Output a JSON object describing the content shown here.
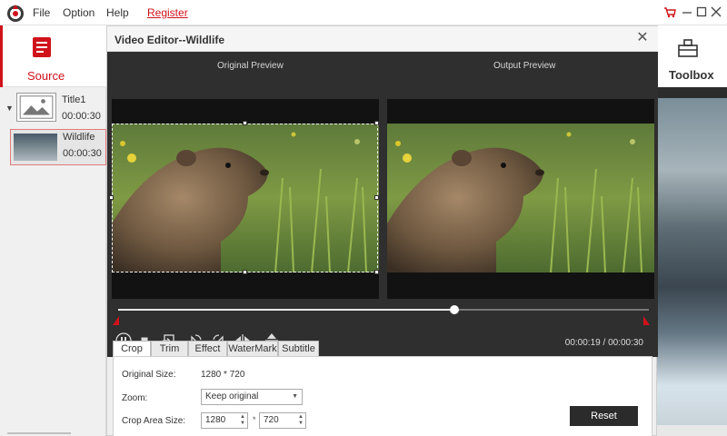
{
  "menu": {
    "file": "File",
    "option": "Option",
    "help": "Help",
    "register": "Register",
    "register_color": "#d0121b"
  },
  "window_controls": {
    "cart": "cart-icon",
    "minimize": "minimize-icon",
    "maximize": "maximize-icon",
    "close": "close-icon"
  },
  "sidebar": {
    "source_label": "Source",
    "title_item": {
      "name": "Title1",
      "duration": "00:00:30"
    },
    "clip_item": {
      "name": "Wildlife",
      "duration": "00:00:30"
    }
  },
  "toolbox": {
    "label": "Toolbox"
  },
  "editor": {
    "title": "Video Editor--Wildlife",
    "original_preview_label": "Original Preview",
    "output_preview_label": "Output Preview",
    "playback_progress": 0.633,
    "time_current": "00:00:19",
    "time_separator": "/",
    "time_total": "00:00:30",
    "controls": [
      "pause-icon",
      "stop-icon",
      "snapshot-icon",
      "rotate-left-icon",
      "rotate-right-icon",
      "flip-horizontal-icon",
      "flip-vertical-icon"
    ]
  },
  "tabs": [
    {
      "label": "Crop",
      "active": true
    },
    {
      "label": "Trim",
      "active": false
    },
    {
      "label": "Effect",
      "active": false
    },
    {
      "label": "WaterMark",
      "active": false
    },
    {
      "label": "Subtitle",
      "active": false
    }
  ],
  "crop": {
    "original_size_label": "Original Size:",
    "original_size_value": "1280 * 720",
    "zoom_label": "Zoom:",
    "zoom_value": "Keep original",
    "crop_area_label": "Crop Area Size:",
    "crop_width": "1280",
    "crop_times": "*",
    "crop_height": "720",
    "reset_label": "Reset"
  },
  "colors": {
    "accent": "#d0121b",
    "dark_panel": "#2f2f2f",
    "button_dark": "#2b2b2b"
  }
}
